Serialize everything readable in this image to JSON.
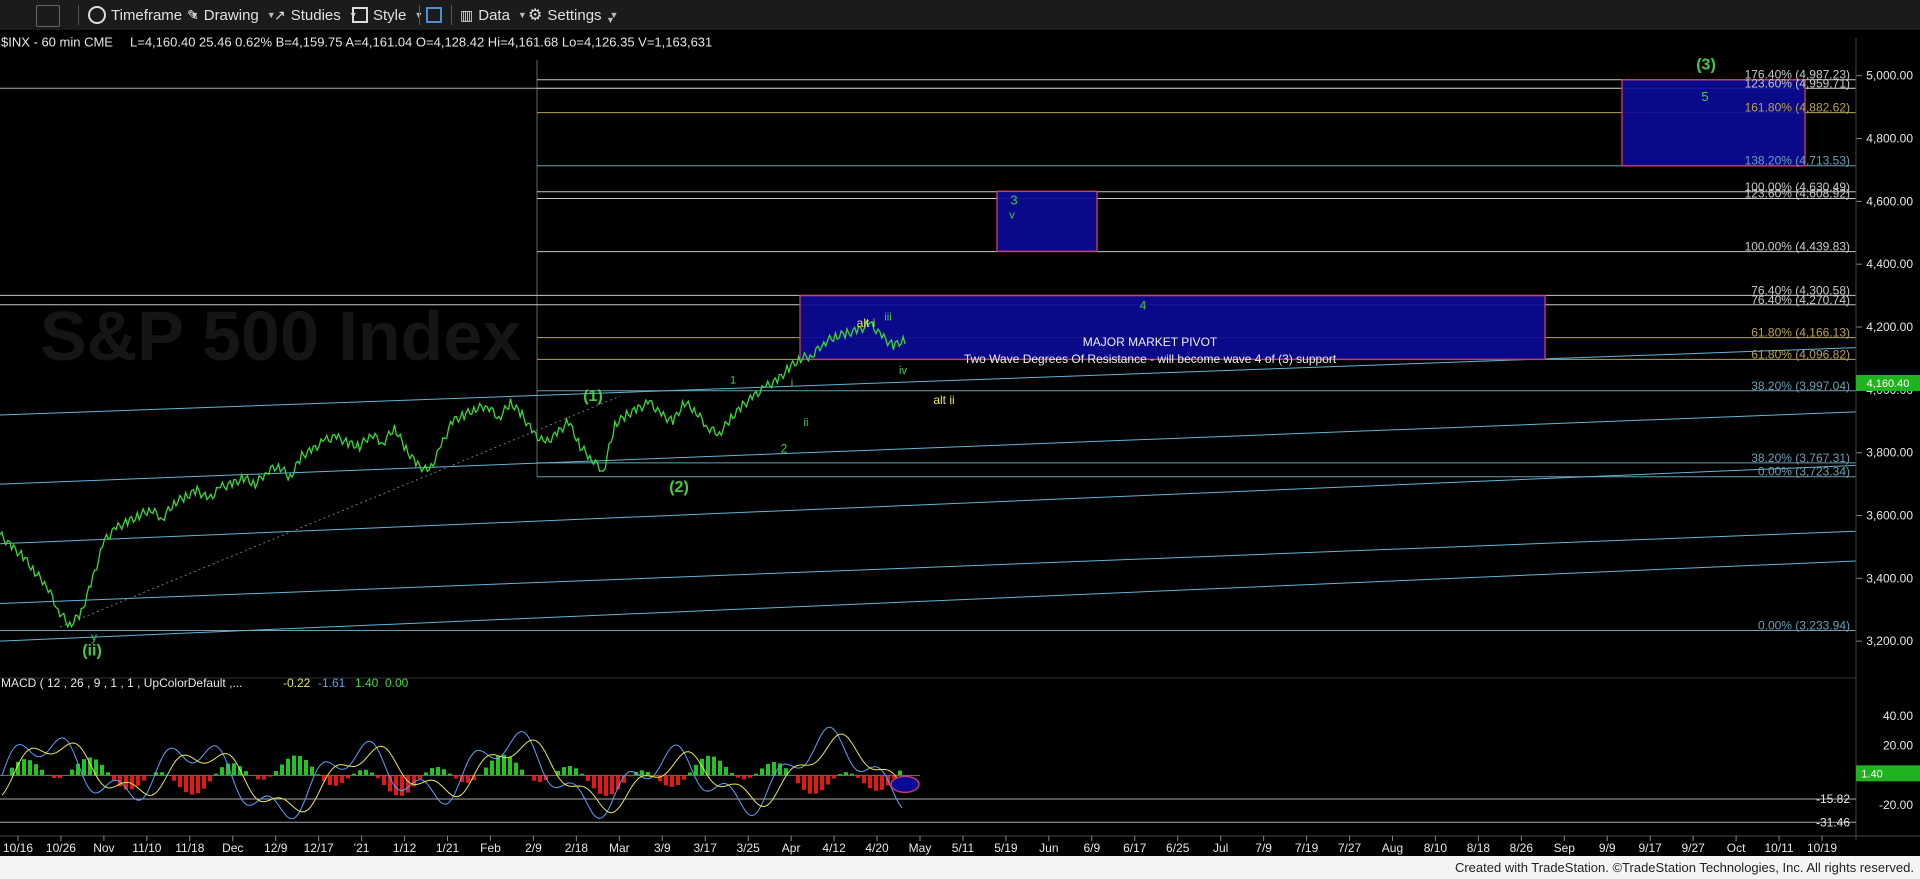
{
  "toolbar": {
    "timeframe": "Timeframe",
    "drawing": "Drawing",
    "studies": "Studies",
    "style": "Style",
    "data": "Data",
    "settings": "Settings"
  },
  "header": {
    "symbol_line": "$INX - 60 min  CME",
    "quote": "L=4,160.40  25.46  0.62%    B=4,159.75  A=4,161.04  O=4,128.42  Hi=4,161.68  Lo=4,126.35  V=1,163,631"
  },
  "macd_header": {
    "label": "MACD ( 12 , 26 , 9 , 1 , 1 , UpColorDefault ,...",
    "v1": "-0.22",
    "v2": "-1.61",
    "v3": "1.40",
    "v4": "0.00"
  },
  "footer": "Created with TradeStation. ©TradeStation Technologies, Inc. All rights reserved.",
  "watermark": "S&P 500 Index",
  "colors": {
    "price": "#33dd33",
    "channel": "#5fb6d8",
    "box_fill": "#0a0a96",
    "box_border": "#c23b6e",
    "wave_green": "#3ecf3e",
    "wave_yellow": "#e8e840",
    "last_price_bg": "#1fb41f",
    "macd_up": "#22c322",
    "macd_down": "#e01818",
    "macd_line": "#5aa0ff",
    "signal_line": "#e8e840"
  },
  "chart_data": {
    "type": "line",
    "symbol": "$INX",
    "interval": "60 min",
    "last_price": "4,160.40",
    "ylim": [
      3140,
      5120
    ],
    "y_ticks": [
      "5,000.00",
      "4,800.00",
      "4,600.00",
      "4,400.00",
      "4,200.00",
      "4,000.00",
      "3,800.00",
      "3,600.00",
      "3,400.00",
      "3,200.00"
    ],
    "x_ticks": [
      "10/16",
      "10/26",
      "Nov",
      "11/10",
      "11/18",
      "Dec",
      "12/9",
      "12/17",
      "'21",
      "1/12",
      "1/21",
      "Feb",
      "2/9",
      "2/18",
      "Mar",
      "3/9",
      "3/17",
      "3/25",
      "Apr",
      "4/12",
      "4/20",
      "May",
      "5/11",
      "5/19",
      "Jun",
      "6/9",
      "6/17",
      "6/25",
      "Jul",
      "7/9",
      "7/19",
      "7/27",
      "Aug",
      "8/10",
      "8/18",
      "8/26",
      "Sep",
      "9/9",
      "9/17",
      "9/27",
      "Oct",
      "10/11",
      "10/19"
    ],
    "series": [
      {
        "values": [
          3540,
          3500,
          3470,
          3420,
          3380,
          3300,
          3250,
          3290,
          3400,
          3520,
          3560,
          3580,
          3600,
          3620,
          3590,
          3640,
          3660,
          3680,
          3650,
          3690,
          3700,
          3720,
          3700,
          3740,
          3760,
          3720,
          3790,
          3810,
          3840,
          3850,
          3830,
          3820,
          3860,
          3830,
          3880,
          3810,
          3760,
          3740,
          3820,
          3900,
          3920,
          3940,
          3950,
          3910,
          3960,
          3920,
          3860,
          3830,
          3860,
          3900,
          3820,
          3780,
          3740,
          3890,
          3920,
          3940,
          3960,
          3920,
          3900,
          3960,
          3930,
          3880,
          3860,
          3910,
          3950,
          3980,
          4010,
          4030,
          4070,
          4100,
          4110,
          4150,
          4170,
          4180,
          4190,
          4210,
          4170,
          4140,
          4160
        ]
      }
    ],
    "fib_levels": [
      {
        "pct": "176.40%",
        "value": "4,987.23"
      },
      {
        "pct": "123.60%",
        "value": "4,959.71"
      },
      {
        "pct": "161.80%",
        "value": "4,882.62"
      },
      {
        "pct": "138.20%",
        "value": "4,713.53"
      },
      {
        "pct": "100.00%",
        "value": "4,630.49"
      },
      {
        "pct": "123.60%",
        "value": "4,608.92"
      },
      {
        "pct": "100.00%",
        "value": "4,439.83"
      },
      {
        "pct": "76.40%",
        "value": "4,300.58"
      },
      {
        "pct": "76.40%",
        "value": "4,270.74"
      },
      {
        "pct": "61.80%",
        "value": "4,166.13"
      },
      {
        "pct": "61.80%",
        "value": "4,096.82"
      },
      {
        "pct": "38.20%",
        "value": "3,997.04"
      },
      {
        "pct": "38.20%",
        "value": "3,767.31"
      },
      {
        "pct": "0.00%",
        "value": "3,723.34"
      },
      {
        "pct": "0.00%",
        "value": "3,233.94"
      }
    ],
    "wave_labels": [
      "(3)",
      "5",
      "3",
      "v",
      "4",
      "alt i",
      "iii",
      "iv",
      "alt ii",
      "1",
      "i",
      "ii",
      "2",
      "(1)",
      "(2)",
      "y",
      "(ii)"
    ],
    "annotations": [
      "MAJOR MARKET PIVOT",
      "Two Wave Degrees Of Resistance - will become wave 4 of (3) support"
    ],
    "macd": {
      "ylim": [
        -38,
        52
      ],
      "y_ticks": [
        "40.00",
        "20.00",
        "-20.00"
      ],
      "levels": [
        "-15.82",
        "-31.46"
      ],
      "current": "1.40"
    }
  }
}
